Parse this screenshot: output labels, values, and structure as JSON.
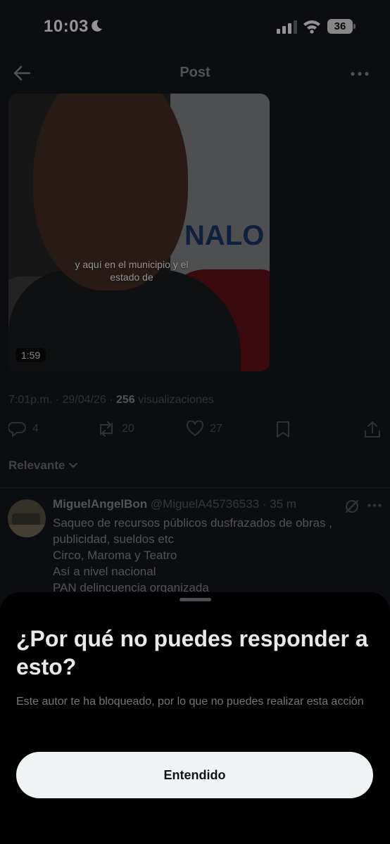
{
  "status_bar": {
    "time": "10:03",
    "battery": "36"
  },
  "header": {
    "title": "Post"
  },
  "post": {
    "video_caption": "y aquí en el municipio y el estado de",
    "video_duration": "1:59",
    "sign_text": "NALO",
    "timestamp": "7:01p.m. · 29/04/26 · ",
    "views_count": "256",
    "views_label": " visualizaciones",
    "replies": "4",
    "reposts": "20",
    "likes": "27"
  },
  "sort": {
    "label": "Relevante"
  },
  "reply": {
    "name": "MiguelAngelBon",
    "handle": "@MiguelA45736533",
    "time": " · 35 m",
    "lines": [
      "Saqueo de recursos públicos dusfrazados de obras ,",
      "publicidad, sueldos etc",
      "Circo, Maroma y Teatro",
      "Así a nivel nacional",
      "PAN delincuencia organizada"
    ]
  },
  "sheet": {
    "title": "¿Por qué no puedes responder a esto?",
    "body": "Este autor te ha bloqueado, por lo que no puedes realizar esta acción",
    "button": "Entendido"
  },
  "colors": {
    "background": "#16181c",
    "sheet": "#000000",
    "button_bg": "#eff3f4",
    "muted_text": "#71767b"
  }
}
